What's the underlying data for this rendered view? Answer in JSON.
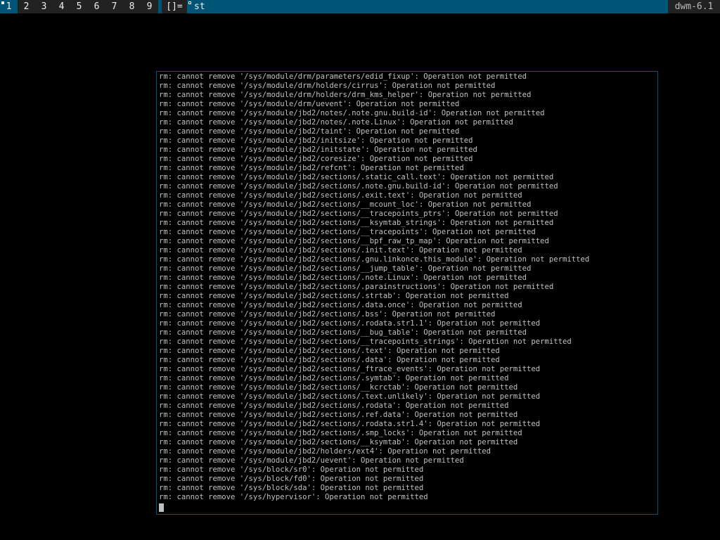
{
  "bar": {
    "tags": [
      "1",
      "2",
      "3",
      "4",
      "5",
      "6",
      "7",
      "8",
      "9"
    ],
    "selected_tag": "1",
    "layout_symbol": "[]=",
    "window_title": "st",
    "status_text": "dwm-6.1"
  },
  "colors": {
    "bar_selected_bg": "#005577",
    "bar_normal_bg": "#222222",
    "bar_fg": "#eeeeee",
    "terminal_bg": "#000000",
    "terminal_fg": "#c0c0c0",
    "window_border": "#005577"
  },
  "terminal": {
    "lines": [
      "rm: cannot remove '/sys/module/drm/parameters/edid_fixup': Operation not permitted",
      "rm: cannot remove '/sys/module/drm/holders/cirrus': Operation not permitted",
      "rm: cannot remove '/sys/module/drm/holders/drm_kms_helper': Operation not permitted",
      "rm: cannot remove '/sys/module/drm/uevent': Operation not permitted",
      "rm: cannot remove '/sys/module/jbd2/notes/.note.gnu.build-id': Operation not permitted",
      "rm: cannot remove '/sys/module/jbd2/notes/.note.Linux': Operation not permitted",
      "rm: cannot remove '/sys/module/jbd2/taint': Operation not permitted",
      "rm: cannot remove '/sys/module/jbd2/initsize': Operation not permitted",
      "rm: cannot remove '/sys/module/jbd2/initstate': Operation not permitted",
      "rm: cannot remove '/sys/module/jbd2/coresize': Operation not permitted",
      "rm: cannot remove '/sys/module/jbd2/refcnt': Operation not permitted",
      "rm: cannot remove '/sys/module/jbd2/sections/.static_call.text': Operation not permitted",
      "rm: cannot remove '/sys/module/jbd2/sections/.note.gnu.build-id': Operation not permitted",
      "rm: cannot remove '/sys/module/jbd2/sections/.exit.text': Operation not permitted",
      "rm: cannot remove '/sys/module/jbd2/sections/__mcount_loc': Operation not permitted",
      "rm: cannot remove '/sys/module/jbd2/sections/__tracepoints_ptrs': Operation not permitted",
      "rm: cannot remove '/sys/module/jbd2/sections/__ksymtab_strings': Operation not permitted",
      "rm: cannot remove '/sys/module/jbd2/sections/__tracepoints': Operation not permitted",
      "rm: cannot remove '/sys/module/jbd2/sections/__bpf_raw_tp_map': Operation not permitted",
      "rm: cannot remove '/sys/module/jbd2/sections/.init.text': Operation not permitted",
      "rm: cannot remove '/sys/module/jbd2/sections/.gnu.linkonce.this_module': Operation not permitted",
      "rm: cannot remove '/sys/module/jbd2/sections/__jump_table': Operation not permitted",
      "rm: cannot remove '/sys/module/jbd2/sections/.note.Linux': Operation not permitted",
      "rm: cannot remove '/sys/module/jbd2/sections/.parainstructions': Operation not permitted",
      "rm: cannot remove '/sys/module/jbd2/sections/.strtab': Operation not permitted",
      "rm: cannot remove '/sys/module/jbd2/sections/.data.once': Operation not permitted",
      "rm: cannot remove '/sys/module/jbd2/sections/.bss': Operation not permitted",
      "rm: cannot remove '/sys/module/jbd2/sections/.rodata.str1.1': Operation not permitted",
      "rm: cannot remove '/sys/module/jbd2/sections/__bug_table': Operation not permitted",
      "rm: cannot remove '/sys/module/jbd2/sections/__tracepoints_strings': Operation not permitted",
      "rm: cannot remove '/sys/module/jbd2/sections/.text': Operation not permitted",
      "rm: cannot remove '/sys/module/jbd2/sections/.data': Operation not permitted",
      "rm: cannot remove '/sys/module/jbd2/sections/_ftrace_events': Operation not permitted",
      "rm: cannot remove '/sys/module/jbd2/sections/.symtab': Operation not permitted",
      "rm: cannot remove '/sys/module/jbd2/sections/__kcrctab': Operation not permitted",
      "rm: cannot remove '/sys/module/jbd2/sections/.text.unlikely': Operation not permitted",
      "rm: cannot remove '/sys/module/jbd2/sections/.rodata': Operation not permitted",
      "rm: cannot remove '/sys/module/jbd2/sections/.ref.data': Operation not permitted",
      "rm: cannot remove '/sys/module/jbd2/sections/.rodata.str1.4': Operation not permitted",
      "rm: cannot remove '/sys/module/jbd2/sections/.smp_locks': Operation not permitted",
      "rm: cannot remove '/sys/module/jbd2/sections/__ksymtab': Operation not permitted",
      "rm: cannot remove '/sys/module/jbd2/holders/ext4': Operation not permitted",
      "rm: cannot remove '/sys/module/jbd2/uevent': Operation not permitted",
      "rm: cannot remove '/sys/block/sr0': Operation not permitted",
      "rm: cannot remove '/sys/block/fd0': Operation not permitted",
      "rm: cannot remove '/sys/block/sda': Operation not permitted",
      "rm: cannot remove '/sys/hypervisor': Operation not permitted"
    ]
  }
}
